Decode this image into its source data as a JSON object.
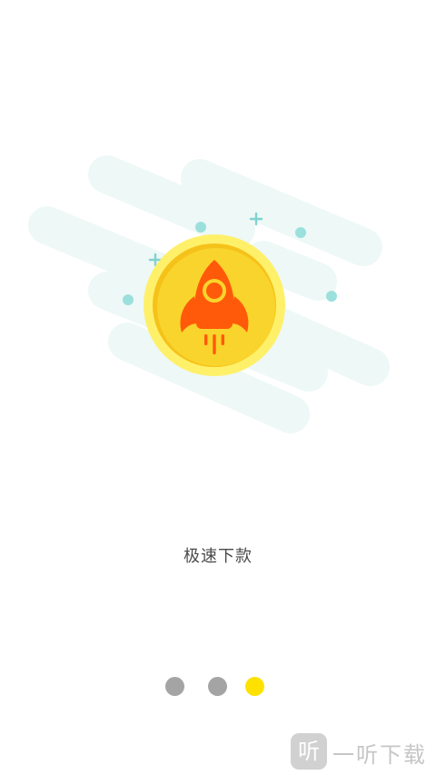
{
  "onboarding": {
    "caption": "极速下款",
    "page_count": 3,
    "active_page": 3,
    "dots": [
      {
        "color": "#a4a4a4"
      },
      {
        "color": "#a4a4a4"
      },
      {
        "color": "#ffe100"
      }
    ]
  },
  "illustration": {
    "icon": "rocket-icon",
    "coin_outer_color": "#fff06a",
    "coin_inner_color": "#f9d42c",
    "rocket_color": "#ff5a0a",
    "cloud_color": "#eef8f7",
    "sparkle_color": "#9be0dc"
  },
  "watermark": {
    "badge": "听",
    "text": "一听下载"
  }
}
